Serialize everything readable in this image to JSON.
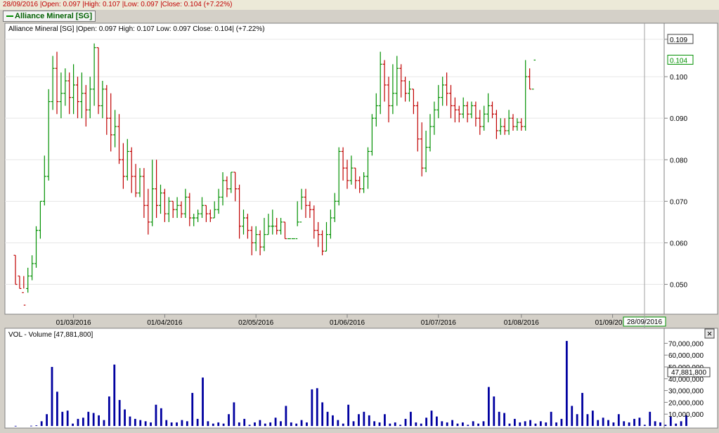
{
  "header": {
    "info_line": "28/09/2016 |Open: 0.097 |High: 0.107 |Low: 0.097 |Close: 0.104 (+7.22%)",
    "tab_label": "Alliance Mineral [SG]",
    "chart_legend": "Alliance Mineral [SG] |Open: 0.097  High: 0.107  Low: 0.097  Close: 0.104| (+7.22%)"
  },
  "volume_panel": {
    "legend": "VOL - Volume [47,881,800]",
    "current_value": "47,881,800",
    "close_glyph": "×"
  },
  "colors": {
    "up": "#009000",
    "down": "#c00000",
    "volume": "#0000a0",
    "accent": "#009000"
  },
  "chart_data": [
    {
      "type": "ohlc",
      "ylim": [
        0.044,
        0.11
      ],
      "price_ticks": [
        "0.050",
        "0.060",
        "0.070",
        "0.080",
        "0.090",
        "0.100",
        "0.109"
      ],
      "price_tick_values": [
        0.05,
        0.06,
        0.07,
        0.08,
        0.09,
        0.1,
        0.109
      ],
      "last_price_label": "0.104",
      "last_price": 0.104,
      "x_tick_labels": [
        "01/03/2016",
        "01/04/2016",
        "02/05/2016",
        "01/06/2016",
        "01/07/2016",
        "01/08/2016",
        "01/09/2016"
      ],
      "x_tick_index": [
        14,
        36,
        58,
        80,
        102,
        122,
        144
      ],
      "x_current_label": "28/09/2016",
      "bar_count": 164,
      "bars": [
        [
          0.057,
          0.05,
          0.057,
          0.05
        ],
        [
          0.052,
          0.049,
          0.052,
          0.049
        ],
        [
          0.048,
          0.045,
          0.052,
          0.049
        ],
        [
          0.049,
          0.052,
          0.054,
          0.048
        ],
        [
          0.052,
          0.055,
          0.057,
          0.051
        ],
        [
          0.055,
          0.063,
          0.064,
          0.054
        ],
        [
          0.063,
          0.07,
          0.07,
          0.061
        ],
        [
          0.07,
          0.076,
          0.081,
          0.069
        ],
        [
          0.076,
          0.094,
          0.097,
          0.075
        ],
        [
          0.094,
          0.102,
          0.105,
          0.092
        ],
        [
          0.102,
          0.094,
          0.106,
          0.091
        ],
        [
          0.094,
          0.096,
          0.101,
          0.09
        ],
        [
          0.096,
          0.099,
          0.102,
          0.093
        ],
        [
          0.099,
          0.095,
          0.101,
          0.091
        ],
        [
          0.095,
          0.098,
          0.103,
          0.091
        ],
        [
          0.098,
          0.094,
          0.1,
          0.09
        ],
        [
          0.094,
          0.096,
          0.101,
          0.09
        ],
        [
          0.096,
          0.092,
          0.098,
          0.088
        ],
        [
          0.092,
          0.097,
          0.1,
          0.09
        ],
        [
          0.097,
          0.107,
          0.108,
          0.093
        ],
        [
          0.107,
          0.093,
          0.107,
          0.091
        ],
        [
          0.093,
          0.097,
          0.099,
          0.09
        ],
        [
          0.097,
          0.09,
          0.098,
          0.086
        ],
        [
          0.09,
          0.086,
          0.096,
          0.082
        ],
        [
          0.086,
          0.088,
          0.092,
          0.083
        ],
        [
          0.088,
          0.08,
          0.091,
          0.079
        ],
        [
          0.08,
          0.076,
          0.084,
          0.073
        ],
        [
          0.076,
          0.082,
          0.085,
          0.075
        ],
        [
          0.082,
          0.076,
          0.083,
          0.072
        ],
        [
          0.076,
          0.072,
          0.079,
          0.071
        ],
        [
          0.072,
          0.076,
          0.078,
          0.071
        ],
        [
          0.076,
          0.069,
          0.078,
          0.066
        ],
        [
          0.069,
          0.065,
          0.073,
          0.062
        ],
        [
          0.065,
          0.073,
          0.08,
          0.064
        ],
        [
          0.073,
          0.069,
          0.08,
          0.066
        ],
        [
          0.069,
          0.072,
          0.074,
          0.067
        ],
        [
          0.072,
          0.067,
          0.073,
          0.065
        ],
        [
          0.067,
          0.07,
          0.071,
          0.065
        ],
        [
          0.07,
          0.068,
          0.07,
          0.066
        ],
        [
          0.068,
          0.069,
          0.071,
          0.066
        ],
        [
          0.069,
          0.067,
          0.07,
          0.066
        ],
        [
          0.067,
          0.071,
          0.073,
          0.066
        ],
        [
          0.071,
          0.066,
          0.072,
          0.064
        ],
        [
          0.066,
          0.066,
          0.067,
          0.064
        ],
        [
          0.066,
          0.067,
          0.068,
          0.065
        ],
        [
          0.067,
          0.069,
          0.071,
          0.066
        ],
        [
          0.069,
          0.067,
          0.069,
          0.065
        ],
        [
          0.067,
          0.066,
          0.068,
          0.065
        ],
        [
          0.066,
          0.068,
          0.07,
          0.066
        ],
        [
          0.068,
          0.071,
          0.073,
          0.067
        ],
        [
          0.071,
          0.075,
          0.077,
          0.069
        ],
        [
          0.075,
          0.073,
          0.076,
          0.071
        ],
        [
          0.073,
          0.077,
          0.077,
          0.072
        ],
        [
          0.077,
          0.073,
          0.077,
          0.07
        ],
        [
          0.073,
          0.064,
          0.074,
          0.061
        ],
        [
          0.064,
          0.066,
          0.068,
          0.062
        ],
        [
          0.066,
          0.063,
          0.067,
          0.061
        ],
        [
          0.063,
          0.06,
          0.064,
          0.057
        ],
        [
          0.06,
          0.062,
          0.064,
          0.058
        ],
        [
          0.062,
          0.059,
          0.063,
          0.057
        ],
        [
          0.059,
          0.062,
          0.066,
          0.058
        ],
        [
          0.062,
          0.064,
          0.067,
          0.062
        ],
        [
          0.064,
          0.064,
          0.068,
          0.062
        ],
        [
          0.064,
          0.063,
          0.066,
          0.062
        ],
        [
          0.063,
          0.065,
          0.066,
          0.062
        ],
        [
          0.065,
          0.061,
          0.065,
          0.061
        ],
        [
          0.061,
          0.061,
          0.061,
          0.061
        ],
        [
          0.061,
          0.061,
          0.061,
          0.061
        ],
        [
          0.061,
          0.065,
          0.07,
          0.064
        ],
        [
          0.065,
          0.071,
          0.073,
          0.068
        ],
        [
          0.071,
          0.069,
          0.073,
          0.066
        ],
        [
          0.069,
          0.068,
          0.07,
          0.066
        ],
        [
          0.068,
          0.063,
          0.069,
          0.061
        ],
        [
          0.063,
          0.062,
          0.065,
          0.059
        ],
        [
          0.062,
          0.058,
          0.063,
          0.057
        ],
        [
          0.058,
          0.062,
          0.065,
          0.058
        ],
        [
          0.062,
          0.066,
          0.068,
          0.061
        ],
        [
          0.066,
          0.07,
          0.072,
          0.065
        ],
        [
          0.07,
          0.082,
          0.083,
          0.069
        ],
        [
          0.082,
          0.078,
          0.083,
          0.075
        ],
        [
          0.078,
          0.075,
          0.08,
          0.073
        ],
        [
          0.075,
          0.078,
          0.081,
          0.074
        ],
        [
          0.078,
          0.075,
          0.078,
          0.073
        ],
        [
          0.075,
          0.073,
          0.076,
          0.072
        ],
        [
          0.073,
          0.076,
          0.077,
          0.072
        ],
        [
          0.076,
          0.082,
          0.083,
          0.073
        ],
        [
          0.082,
          0.09,
          0.091,
          0.081
        ],
        [
          0.09,
          0.093,
          0.096,
          0.088
        ],
        [
          0.093,
          0.103,
          0.106,
          0.091
        ],
        [
          0.103,
          0.098,
          0.104,
          0.094
        ],
        [
          0.098,
          0.093,
          0.1,
          0.089
        ],
        [
          0.093,
          0.096,
          0.103,
          0.091
        ],
        [
          0.096,
          0.102,
          0.105,
          0.093
        ],
        [
          0.102,
          0.099,
          0.103,
          0.095
        ],
        [
          0.099,
          0.096,
          0.1,
          0.094
        ],
        [
          0.096,
          0.097,
          0.099,
          0.094
        ],
        [
          0.097,
          0.093,
          0.097,
          0.091
        ],
        [
          0.093,
          0.085,
          0.094,
          0.082
        ],
        [
          0.085,
          0.078,
          0.089,
          0.076
        ],
        [
          0.078,
          0.083,
          0.087,
          0.077
        ],
        [
          0.083,
          0.088,
          0.091,
          0.082
        ],
        [
          0.088,
          0.092,
          0.094,
          0.086
        ],
        [
          0.092,
          0.095,
          0.098,
          0.09
        ],
        [
          0.095,
          0.098,
          0.1,
          0.093
        ],
        [
          0.098,
          0.096,
          0.101,
          0.093
        ],
        [
          0.096,
          0.093,
          0.098,
          0.09
        ],
        [
          0.093,
          0.092,
          0.095,
          0.089
        ],
        [
          0.092,
          0.091,
          0.093,
          0.089
        ],
        [
          0.091,
          0.093,
          0.095,
          0.09
        ],
        [
          0.093,
          0.091,
          0.094,
          0.089
        ],
        [
          0.091,
          0.093,
          0.094,
          0.09
        ],
        [
          0.093,
          0.09,
          0.094,
          0.088
        ],
        [
          0.09,
          0.088,
          0.092,
          0.086
        ],
        [
          0.088,
          0.091,
          0.093,
          0.087
        ],
        [
          0.091,
          0.093,
          0.096,
          0.089
        ],
        [
          0.093,
          0.091,
          0.094,
          0.09
        ],
        [
          0.091,
          0.087,
          0.092,
          0.085
        ],
        [
          0.087,
          0.088,
          0.09,
          0.086
        ],
        [
          0.088,
          0.087,
          0.09,
          0.086
        ],
        [
          0.087,
          0.09,
          0.092,
          0.086
        ],
        [
          0.09,
          0.088,
          0.091,
          0.087
        ],
        [
          0.088,
          0.089,
          0.09,
          0.087
        ],
        [
          0.089,
          0.088,
          0.09,
          0.087
        ],
        [
          0.088,
          0.1,
          0.104,
          0.087
        ],
        [
          0.1,
          0.097,
          0.102,
          0.097
        ],
        [
          0.097,
          0.104,
          0.104,
          0.104
        ]
      ]
    },
    {
      "type": "bar",
      "series_label": "VOL - Volume",
      "ylim": [
        0,
        75000000
      ],
      "y_ticks": [
        "10,000,000",
        "20,000,000",
        "30,000,000",
        "40,000,000",
        "50,000,000",
        "60,000,000",
        "70,000,000"
      ],
      "y_tick_values": [
        10000000,
        20000000,
        30000000,
        40000000,
        50000000,
        60000000,
        70000000
      ],
      "values": [
        100000,
        0,
        0,
        200000,
        500000,
        4000000,
        10000000,
        50000000,
        29000000,
        12000000,
        13000000,
        2000000,
        6000000,
        7000000,
        12000000,
        11000000,
        9000000,
        5000000,
        25000000,
        52000000,
        22000000,
        14000000,
        8000000,
        6000000,
        5000000,
        4000000,
        3000000,
        18000000,
        15000000,
        5000000,
        3000000,
        3000000,
        5000000,
        4000000,
        28000000,
        6000000,
        41000000,
        4000000,
        2000000,
        3000000,
        2000000,
        10000000,
        20000000,
        3000000,
        6000000,
        1000000,
        3000000,
        5000000,
        2000000,
        3000000,
        7000000,
        4000000,
        17000000,
        3000000,
        2000000,
        5000000,
        3000000,
        31000000,
        32000000,
        20000000,
        12000000,
        9000000,
        5000000,
        2000000,
        18000000,
        4000000,
        10000000,
        12000000,
        9000000,
        4000000,
        3000000,
        10000000,
        2000000,
        3000000,
        1000000,
        6000000,
        12000000,
        3000000,
        2000000,
        7000000,
        13000000,
        8000000,
        4000000,
        3000000,
        5000000,
        2000000,
        3000000,
        1000000,
        4000000,
        2000000,
        4000000,
        33000000,
        25000000,
        12000000,
        11000000,
        2000000,
        6000000,
        3000000,
        4000000,
        5000000,
        2000000,
        4000000,
        3000000,
        12000000,
        3000000,
        6000000,
        72000000,
        17000000,
        10000000,
        28000000,
        10000000,
        13000000,
        5000000,
        7000000,
        5000000,
        3000000,
        10000000,
        4000000,
        3000000,
        6000000,
        7000000,
        1000000,
        12000000,
        4000000,
        3000000,
        1000000,
        8000000,
        2000000,
        4000000,
        9000000,
        0
      ]
    }
  ]
}
